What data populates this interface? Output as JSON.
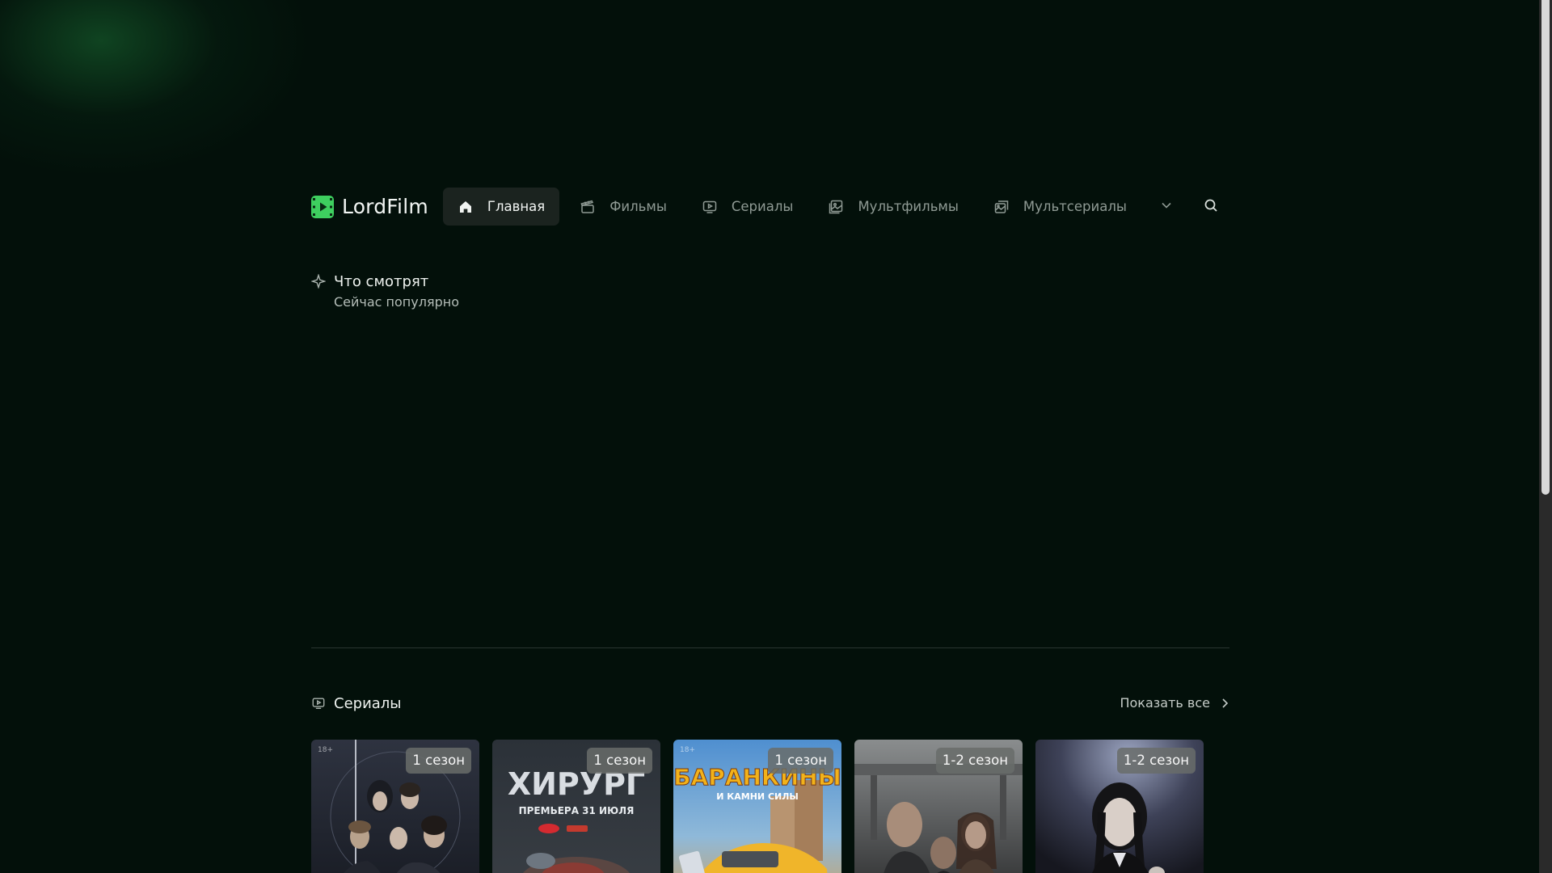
{
  "header": {
    "logo_text": "LordFilm",
    "nav": [
      {
        "label": "Главная",
        "icon": "home-icon",
        "active": true
      },
      {
        "label": "Фильмы",
        "icon": "clapperboard-icon",
        "active": false
      },
      {
        "label": "Сериалы",
        "icon": "tv-icon",
        "active": false
      },
      {
        "label": "Мультфильмы",
        "icon": "image-icon",
        "active": false
      },
      {
        "label": "Мультсериалы",
        "icon": "images-icon",
        "active": false
      }
    ],
    "more_icon": "chevron-down-icon",
    "search_icon": "search-icon"
  },
  "trending": {
    "icon": "sparkle-icon",
    "title": "Что смотрят",
    "subtitle": "Сейчас популярно"
  },
  "series_section": {
    "icon": "tv-icon",
    "title": "Сериалы",
    "show_all": "Показать все",
    "cards": [
      {
        "badge": "1 сезон",
        "age": "18+",
        "poster_text": "",
        "poster_sub": ""
      },
      {
        "badge": "1 сезон",
        "age": "",
        "poster_text": "ХИРУРГ",
        "poster_sub": "ПРЕМЬЕРА 31 ИЮЛЯ"
      },
      {
        "badge": "1 сезон",
        "age": "18+",
        "poster_text": "БАРАНКИНЫ",
        "poster_sub": "И КАМНИ СИЛЫ"
      },
      {
        "badge": "1-2 сезон",
        "age": "",
        "poster_text": "",
        "poster_sub": ""
      },
      {
        "badge": "1-2 сезон",
        "age": "",
        "poster_text": "",
        "poster_sub": ""
      }
    ]
  },
  "colors": {
    "background": "#03100a",
    "accent": "#3ecf5f",
    "active_nav_bg": "#1b231f"
  }
}
